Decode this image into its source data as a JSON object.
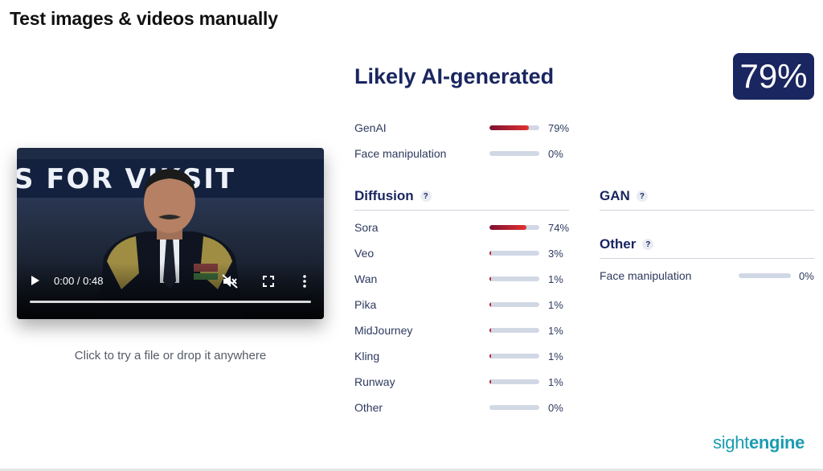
{
  "page": {
    "title": "Test images & videos manually"
  },
  "video": {
    "banner_text": "S FOR VIKSIT",
    "time": "0:00 / 0:48",
    "progress": 0,
    "icons": [
      "play-icon",
      "mute-icon",
      "fullscreen-icon",
      "more-vert-icon"
    ]
  },
  "upload": {
    "hint": "Click to try a file or drop it anywhere"
  },
  "result": {
    "verdict": "Likely AI-generated",
    "score": "79%",
    "overall": [
      {
        "label": "GenAI",
        "value": 79,
        "pct": "79%"
      },
      {
        "label": "Face manipulation",
        "value": 0,
        "pct": "0%"
      }
    ]
  },
  "diffusion": {
    "title": "Diffusion",
    "help": "?",
    "items": [
      {
        "label": "Sora",
        "value": 74,
        "pct": "74%"
      },
      {
        "label": "Veo",
        "value": 3,
        "pct": "3%"
      },
      {
        "label": "Wan",
        "value": 1,
        "pct": "1%"
      },
      {
        "label": "Pika",
        "value": 1,
        "pct": "1%"
      },
      {
        "label": "MidJourney",
        "value": 1,
        "pct": "1%"
      },
      {
        "label": "Kling",
        "value": 1,
        "pct": "1%"
      },
      {
        "label": "Runway",
        "value": 1,
        "pct": "1%"
      },
      {
        "label": "Other",
        "value": 0,
        "pct": "0%"
      }
    ]
  },
  "gan": {
    "title": "GAN",
    "help": "?"
  },
  "other": {
    "title": "Other",
    "help": "?",
    "items": [
      {
        "label": "Face manipulation",
        "value": 0,
        "pct": "0%"
      }
    ]
  },
  "brand": {
    "part1": "sight",
    "part2": "engine"
  },
  "colors": {
    "accent": "#1a2660",
    "bar_track": "#d1d8e5",
    "bar_fill_start": "#7d1133",
    "bar_fill_end": "#e2312f",
    "brand": "#1a9cb0"
  }
}
